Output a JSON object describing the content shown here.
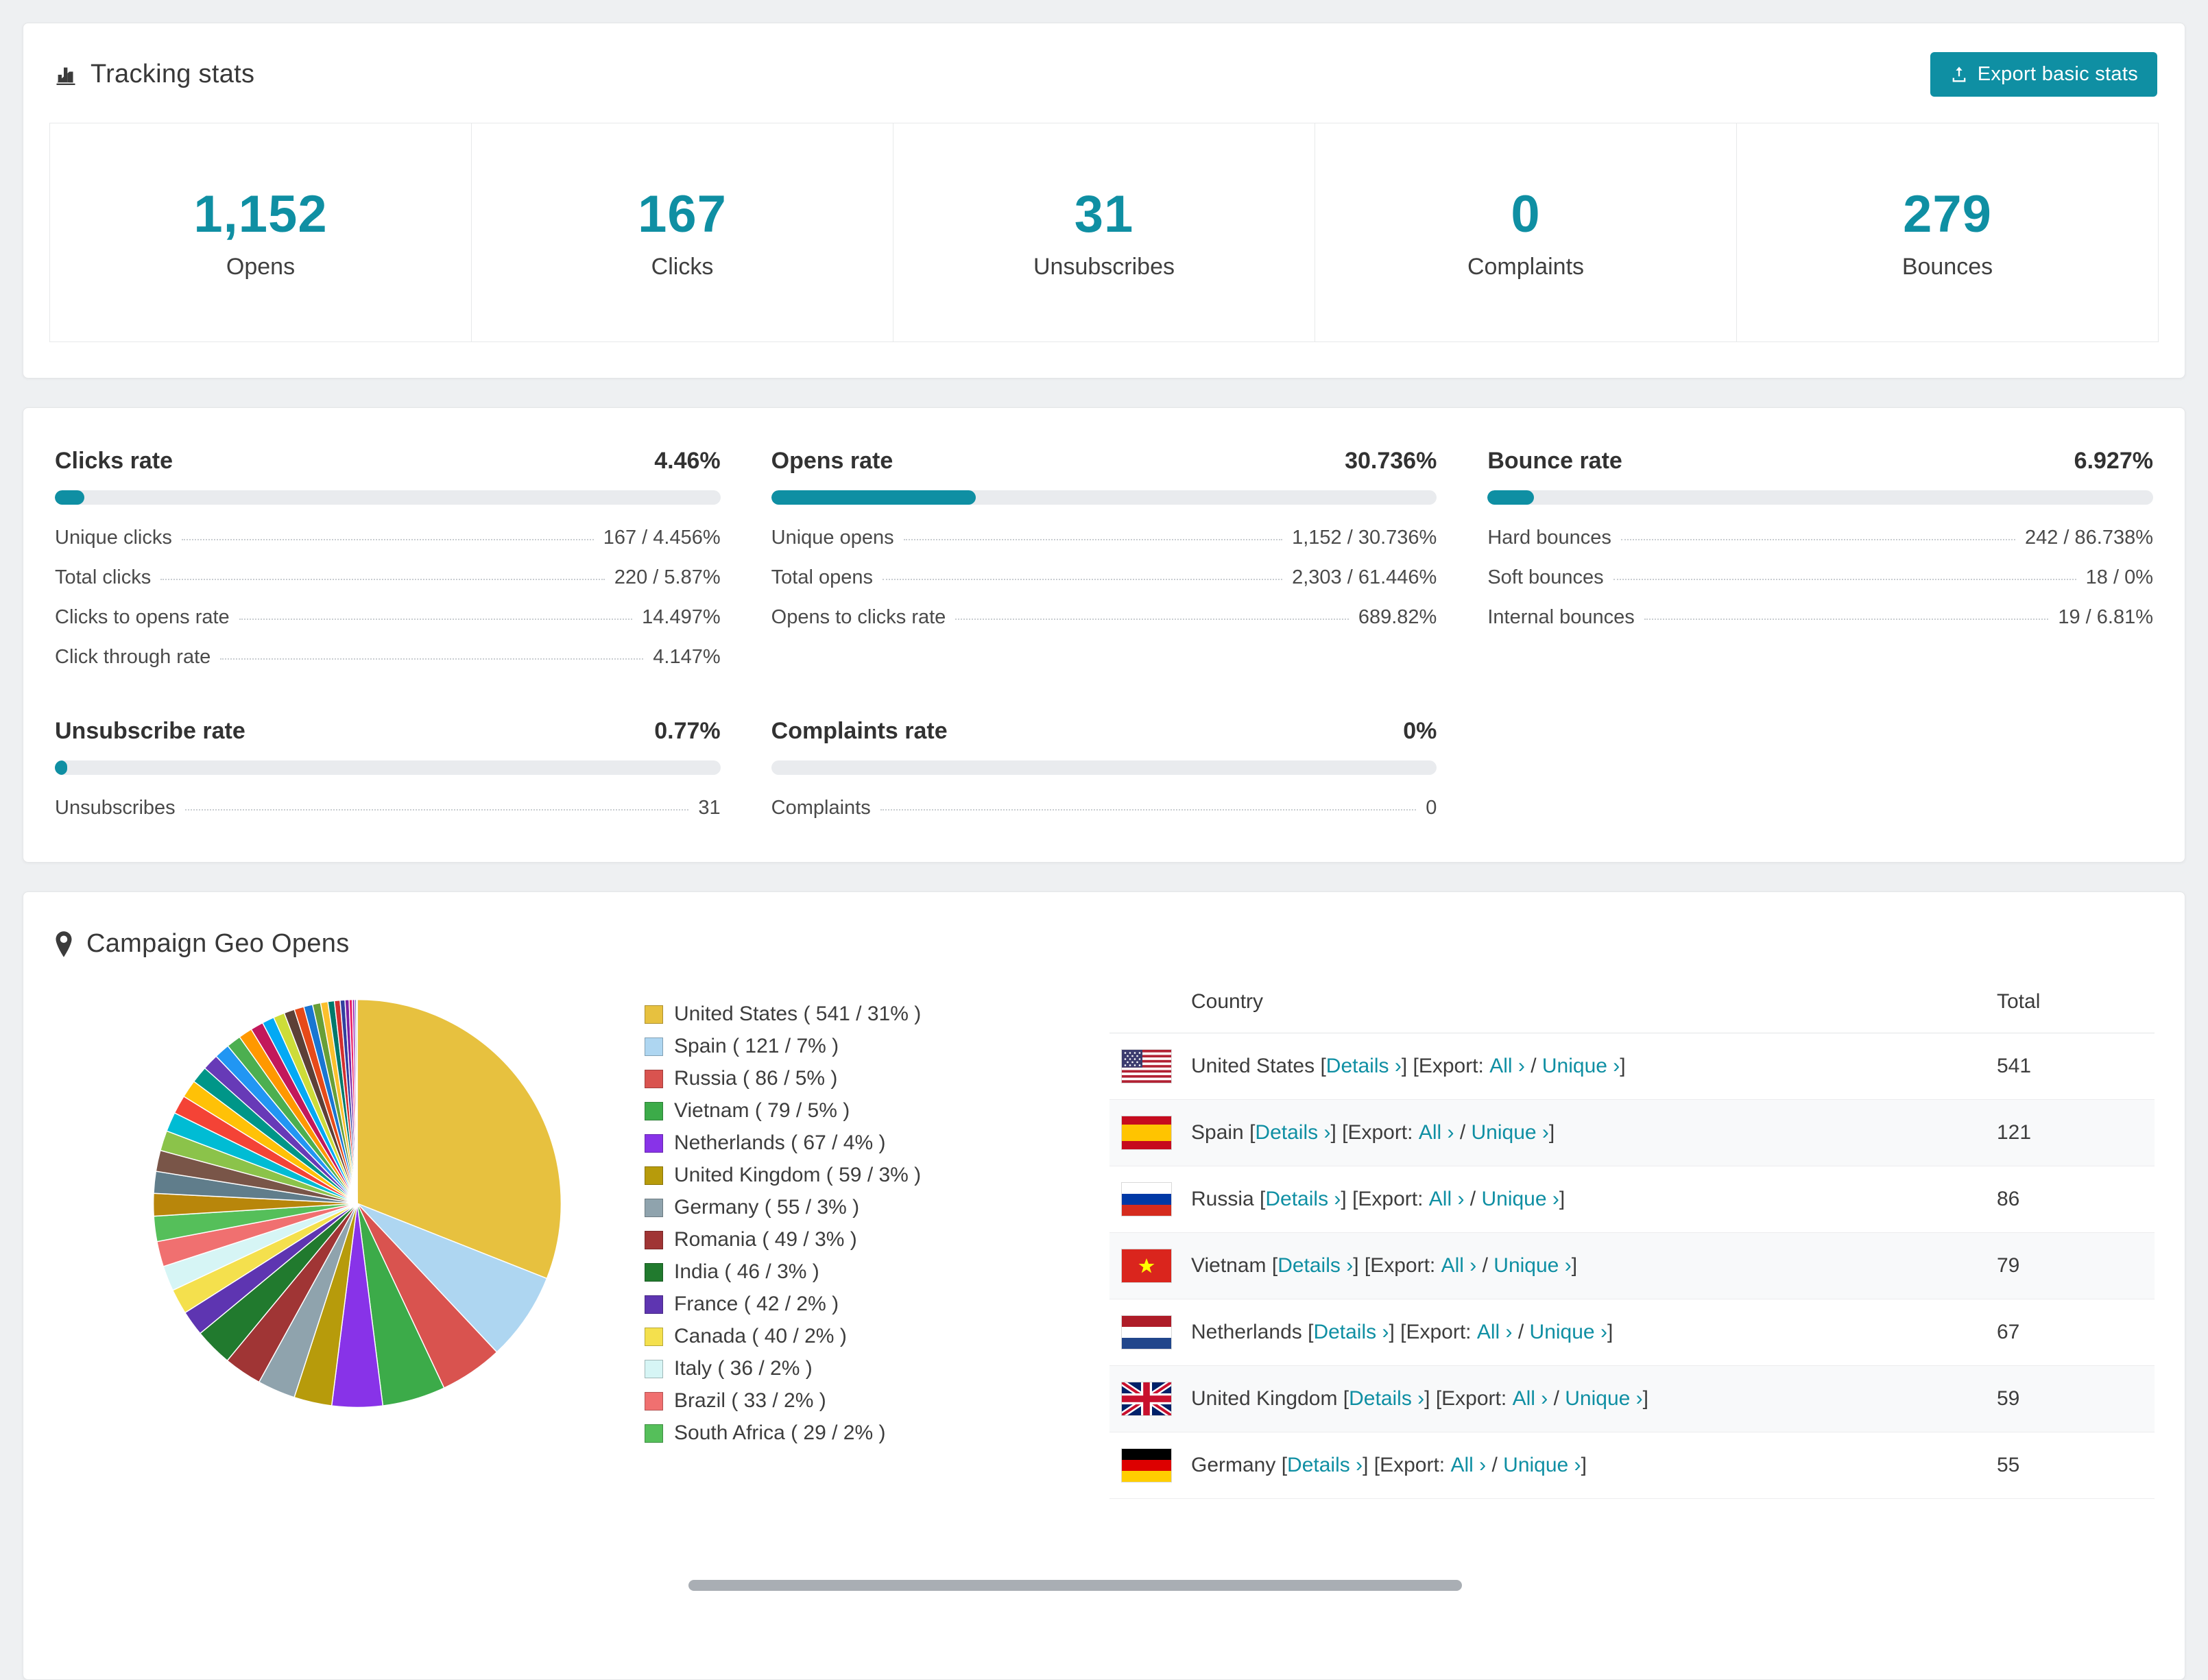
{
  "colors": {
    "accent": "#0f8fa3",
    "progress_track": "#e9ebee",
    "page_background": "#eef0f2"
  },
  "tracking": {
    "title": "Tracking stats",
    "export_button": "Export basic stats",
    "stats": [
      {
        "value": "1,152",
        "label": "Opens"
      },
      {
        "value": "167",
        "label": "Clicks"
      },
      {
        "value": "31",
        "label": "Unsubscribes"
      },
      {
        "value": "0",
        "label": "Complaints"
      },
      {
        "value": "279",
        "label": "Bounces"
      }
    ]
  },
  "rates": [
    {
      "title": "Clicks rate",
      "value": "4.46%",
      "percent": 4.46,
      "rows": [
        {
          "label": "Unique clicks",
          "value": "167 / 4.456%"
        },
        {
          "label": "Total clicks",
          "value": "220 / 5.87%"
        },
        {
          "label": "Clicks to opens rate",
          "value": "14.497%"
        },
        {
          "label": "Click through rate",
          "value": "4.147%"
        }
      ]
    },
    {
      "title": "Opens rate",
      "value": "30.736%",
      "percent": 30.736,
      "rows": [
        {
          "label": "Unique opens",
          "value": "1,152 / 30.736%"
        },
        {
          "label": "Total opens",
          "value": "2,303 / 61.446%"
        },
        {
          "label": "Opens to clicks rate",
          "value": "689.82%"
        }
      ]
    },
    {
      "title": "Bounce rate",
      "value": "6.927%",
      "percent": 6.927,
      "rows": [
        {
          "label": "Hard bounces",
          "value": "242 / 86.738%"
        },
        {
          "label": "Soft bounces",
          "value": "18 / 0%"
        },
        {
          "label": "Internal bounces",
          "value": "19 / 6.81%"
        }
      ]
    },
    {
      "title": "Unsubscribe rate",
      "value": "0.77%",
      "percent": 0.77,
      "rows": [
        {
          "label": "Unsubscribes",
          "value": "31"
        }
      ]
    },
    {
      "title": "Complaints rate",
      "value": "0%",
      "percent": 0,
      "rows": [
        {
          "label": "Complaints",
          "value": "0"
        }
      ]
    }
  ],
  "geo": {
    "title": "Campaign Geo Opens",
    "table": {
      "headers": [
        "Country",
        "Total"
      ],
      "details_label": "Details ›",
      "all_label": "All ›",
      "unique_label": "Unique ›",
      "rows": [
        {
          "country": "United States",
          "flag": "us",
          "total": "541"
        },
        {
          "country": "Spain",
          "flag": "es",
          "total": "121"
        },
        {
          "country": "Russia",
          "flag": "ru",
          "total": "86"
        },
        {
          "country": "Vietnam",
          "flag": "vn",
          "total": "79"
        },
        {
          "country": "Netherlands",
          "flag": "nl",
          "total": "67"
        },
        {
          "country": "United Kingdom",
          "flag": "gb",
          "total": "59"
        },
        {
          "country": "Germany",
          "flag": "de",
          "total": "55"
        }
      ]
    },
    "chart_data": {
      "type": "pie",
      "title": "Campaign Geo Opens",
      "legend_position": "right",
      "labels": [
        "United States",
        "Spain",
        "Russia",
        "Vietnam",
        "Netherlands",
        "United Kingdom",
        "Germany",
        "Romania",
        "India",
        "France",
        "Canada",
        "Italy",
        "Brazil",
        "South Africa"
      ],
      "values": [
        541,
        121,
        86,
        79,
        67,
        59,
        55,
        49,
        46,
        42,
        40,
        36,
        33,
        29
      ],
      "percents": [
        31,
        7,
        5,
        5,
        4,
        3,
        3,
        3,
        3,
        2,
        2,
        2,
        2,
        2
      ],
      "colors": [
        "#e7c13f",
        "#aed6f1",
        "#d9534f",
        "#3cab49",
        "#8833e8",
        "#b79b0b",
        "#8fa3ad",
        "#a03535",
        "#217a2e",
        "#5e35b1",
        "#f4e04d",
        "#d6f5f5",
        "#f07070",
        "#55bf5a"
      ],
      "other_slices_percent": 26,
      "tail_colors": [
        "#b8860b",
        "#607d8b",
        "#795548",
        "#8bc34a",
        "#00bcd4",
        "#f44336",
        "#ffc107",
        "#009688",
        "#673ab7",
        "#2196f3",
        "#4caf50",
        "#ff9800",
        "#c2185b",
        "#03a9f4",
        "#cddc39",
        "#5d4037",
        "#e64a19",
        "#1976d2",
        "#689f38",
        "#fbc02d",
        "#00796b",
        "#d32f2f",
        "#303f9f",
        "#7b1fa2",
        "#e91e63",
        "#9c27b0",
        "#3f51b5",
        "#ce93d8"
      ]
    }
  }
}
